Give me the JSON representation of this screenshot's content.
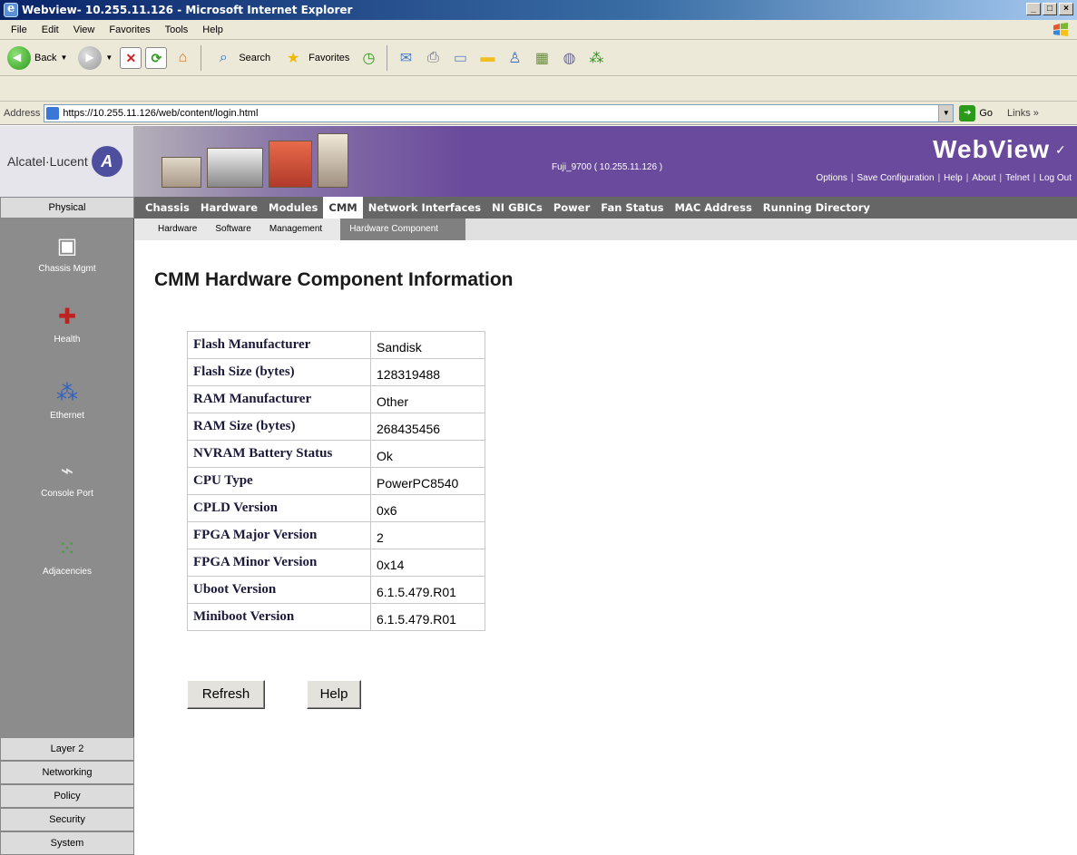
{
  "window": {
    "title": "Webview- 10.255.11.126 - Microsoft Internet Explorer",
    "controls": [
      "_",
      "□",
      "×"
    ]
  },
  "menu": [
    "File",
    "Edit",
    "View",
    "Favorites",
    "Tools",
    "Help"
  ],
  "toolbar": {
    "back": "Back",
    "search": "Search",
    "favorites": "Favorites"
  },
  "address": {
    "label": "Address",
    "url": "https://10.255.11.126/web/content/login.html",
    "go": "Go",
    "links": "Links »"
  },
  "header": {
    "brand_company": "Alcatel·Lucent",
    "device_id": "Fuji_9700  ( 10.255.11.126 )",
    "product": "WebView",
    "links": [
      "Options",
      "Save Configuration",
      "Help",
      "About",
      "Telnet",
      "Log Out"
    ]
  },
  "nav": {
    "physical": "Physical",
    "items": [
      "Chassis",
      "Hardware",
      "Modules",
      "CMM",
      "Network Interfaces",
      "NI GBICs",
      "Power",
      "Fan Status",
      "MAC Address",
      "Running Directory"
    ],
    "active": "CMM"
  },
  "subnav": {
    "items": [
      "Hardware",
      "Software",
      "Management",
      "Hardware Component"
    ],
    "active": "Hardware Component"
  },
  "sidebar": {
    "items": [
      "Chassis Mgmt",
      "Health",
      "Ethernet",
      "Console Port",
      "Adjacencies"
    ],
    "bottom_tabs": [
      "Layer 2",
      "Networking",
      "Policy",
      "Security",
      "System"
    ]
  },
  "main": {
    "title": "CMM Hardware Component Information",
    "rows": [
      {
        "key": "Flash Manufacturer",
        "value": "Sandisk"
      },
      {
        "key": "Flash Size (bytes)",
        "value": "128319488"
      },
      {
        "key": "RAM Manufacturer",
        "value": "Other"
      },
      {
        "key": "RAM Size (bytes)",
        "value": "268435456"
      },
      {
        "key": "NVRAM Battery Status",
        "value": "Ok"
      },
      {
        "key": "CPU Type",
        "value": "PowerPC8540"
      },
      {
        "key": "CPLD Version",
        "value": "0x6"
      },
      {
        "key": "FPGA Major Version",
        "value": "2"
      },
      {
        "key": "FPGA Minor Version",
        "value": "0x14"
      },
      {
        "key": "Uboot Version",
        "value": "6.1.5.479.R01"
      },
      {
        "key": "Miniboot Version",
        "value": "6.1.5.479.R01"
      }
    ],
    "refresh_label": "Refresh",
    "help_label": "Help"
  }
}
